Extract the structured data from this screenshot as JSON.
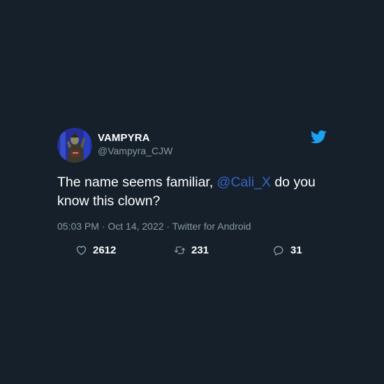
{
  "user": {
    "display_name": "VAMPYRA",
    "handle": "@Vampyra_CJW"
  },
  "tweet": {
    "text_before": "The name seems familiar, ",
    "mention": "@Cali_X",
    "text_after": " do you know this clown?",
    "timestamp": "05:03 PM · Oct 14, 2022 · Twitter for Android"
  },
  "stats": {
    "likes": "2612",
    "retweets": "231",
    "replies": "31"
  },
  "icons": {
    "brand": "twitter-bird-icon",
    "like": "heart-icon",
    "retweet": "retweet-icon",
    "reply": "reply-icon"
  },
  "colors": {
    "background": "#15202b",
    "secondary_text": "#8899a6",
    "mention": "#3a63c5",
    "twitter_blue": "#1da1f2"
  }
}
